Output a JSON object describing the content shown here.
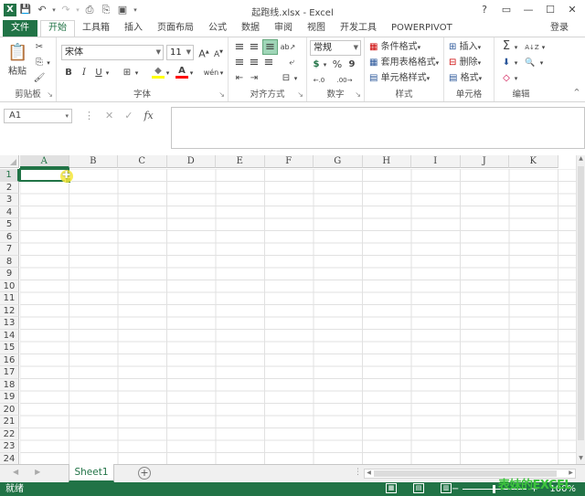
{
  "window": {
    "title": "起跑线.xlsx - Excel",
    "controls": {
      "help": "?",
      "restore": "▭",
      "minimize": "—",
      "maximize": "☐",
      "close": "✕"
    }
  },
  "qat": {
    "excel_logo": "X",
    "save": "💾",
    "undo": "↶",
    "undo_arrow": "▾",
    "redo": "↷",
    "redo_arrow": "▾",
    "print": "⎙",
    "preview": "⎘",
    "form": "▣",
    "customize": "▾"
  },
  "tabs": [
    "文件",
    "开始",
    "工具箱",
    "插入",
    "页面布局",
    "公式",
    "数据",
    "审阅",
    "视图",
    "开发工具",
    "POWERPIVOT"
  ],
  "signin": "登录",
  "ribbon": {
    "clipboard": {
      "label": "剪贴板",
      "paste": "粘贴",
      "paste_icon": "📋",
      "cut": "✂",
      "copy": "⎘",
      "copy_arrow": "▾",
      "format_painter": "🖌"
    },
    "font": {
      "label": "字体",
      "name": "宋体",
      "size": "11",
      "grow": "A",
      "grow_mark": "▲",
      "shrink": "A",
      "shrink_mark": "▼",
      "bold": "B",
      "italic": "I",
      "underline": "U",
      "underline_arrow": "▾",
      "border": "⊞",
      "border_arrow": "▾",
      "fill": "◆",
      "fill_arrow": "▾",
      "color": "A",
      "color_arrow": "▾",
      "phonetic": "wén",
      "phonetic_arrow": "▾"
    },
    "alignment": {
      "label": "对齐方式",
      "top": "≡",
      "middle": "≡",
      "bottom": "≡",
      "orient": "ab↗",
      "left": "≡",
      "center": "≡",
      "right": "≡",
      "indent_dec": "⇤",
      "indent_inc": "⇥",
      "wrap": "⤶",
      "merge": "⊟",
      "merge_arrow": "▾"
    },
    "number": {
      "label": "数字",
      "format": "常规",
      "currency": "$",
      "currency_arrow": "▾",
      "percent": "%",
      "comma": "9",
      "inc": "←.0",
      "dec": ".00→"
    },
    "styles": {
      "label": "样式",
      "conditional": "条件格式",
      "table": "套用表格格式",
      "cell": "单元格样式",
      "arrow": "▾"
    },
    "cells": {
      "label": "单元格",
      "insert": "插入",
      "delete": "删除",
      "format": "格式",
      "arrow": "▾"
    },
    "editing": {
      "label": "编辑",
      "sum": "Σ",
      "sort": "A↓Z",
      "fill": "⬇",
      "find": "🔍",
      "clear": "◇",
      "arrow": "▾"
    },
    "launcher": "↘"
  },
  "formula_bar": {
    "name_box": "A1",
    "name_arrow": "▾",
    "dots": "⋮",
    "cancel": "✕",
    "enter": "✓",
    "fx": "fx",
    "value": ""
  },
  "grid": {
    "columns": [
      "A",
      "B",
      "C",
      "D",
      "E",
      "F",
      "G",
      "H",
      "I",
      "J",
      "K"
    ],
    "rows": [
      "1",
      "2",
      "3",
      "4",
      "5",
      "6",
      "7",
      "8",
      "9",
      "10",
      "11",
      "12",
      "13",
      "14",
      "15",
      "16",
      "17",
      "18",
      "19",
      "20",
      "21",
      "22",
      "23",
      "24"
    ],
    "active_cell": "A1"
  },
  "scroll": {
    "up": "▲",
    "down": "▼",
    "left": "◀",
    "right": "▶"
  },
  "sheets": {
    "nav_prev": "◀",
    "nav_next": "▶",
    "tabs": [
      "Sheet1"
    ],
    "add": "+",
    "split": "⋮"
  },
  "status": {
    "ready": "就绪",
    "view_normal": "▦",
    "view_layout": "▤",
    "view_break": "▥",
    "zoom_out": "−",
    "zoom_in": "+",
    "zoom": "100%"
  },
  "watermark": "表妹的EXCEL"
}
